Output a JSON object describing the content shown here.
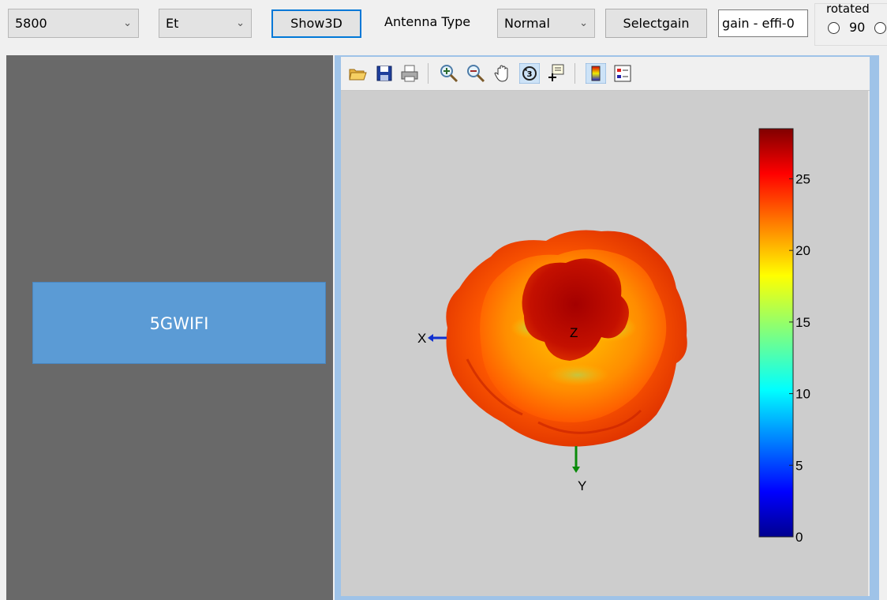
{
  "toolbar": {
    "frequency": "5800",
    "field": "Et",
    "show3d": "Show3D",
    "antenna_type_label": "Antenna Type",
    "antenna_type": "Normal",
    "selectgain": "Selectgain",
    "gain_field": "gain - effi-0",
    "rotated_label": "rotated",
    "rotated_option_90": "90"
  },
  "device": {
    "label": "5GWIFI"
  },
  "plot": {
    "axis_x": "X",
    "axis_y": "Y",
    "axis_z": "Z",
    "colorbar_ticks": [
      "25",
      "20",
      "15",
      "10",
      "5",
      "0"
    ],
    "colorbar_range": [
      0,
      28.5
    ],
    "colormap": "jet"
  },
  "figure_toolbar": {
    "icons": [
      "open-icon",
      "save-icon",
      "print-icon",
      "zoom-in-icon",
      "zoom-out-icon",
      "pan-icon",
      "rotate3d-icon",
      "data-cursor-icon",
      "colorbar-icon",
      "legend-icon"
    ]
  }
}
